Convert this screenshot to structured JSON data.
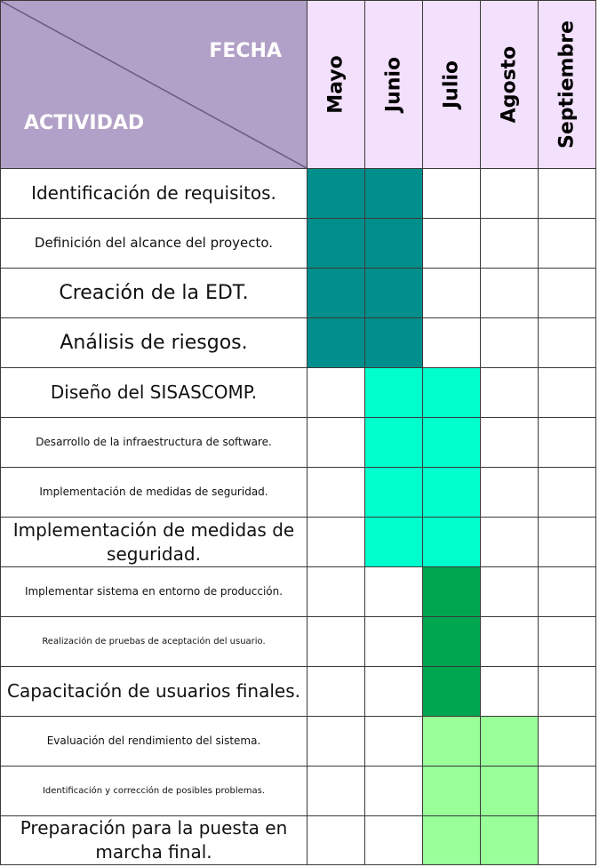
{
  "header": {
    "fecha_label": "FECHA",
    "actividad_label": "ACTIVIDAD",
    "months": [
      "Mayo",
      "Junio",
      "Julio",
      "Agosto",
      "Septiembre"
    ]
  },
  "colors": {
    "header_corner": "#b1a0c7",
    "header_month": "#f2e0fc",
    "phase_1": "#008f8c",
    "phase_2": "#00ffcc",
    "phase_3": "#00a650",
    "phase_4": "#99ff99"
  },
  "activities": [
    {
      "label": "Identificación de requisitos.",
      "months": [
        1,
        1,
        0,
        0,
        0
      ],
      "phase": 1
    },
    {
      "label": "Definición del alcance del proyecto.",
      "months": [
        1,
        1,
        0,
        0,
        0
      ],
      "phase": 1
    },
    {
      "label": "Creación de la EDT.",
      "months": [
        1,
        1,
        0,
        0,
        0
      ],
      "phase": 1
    },
    {
      "label": "Análisis de riesgos.",
      "months": [
        1,
        1,
        0,
        0,
        0
      ],
      "phase": 1
    },
    {
      "label": "Diseño del SISASCOMP.",
      "months": [
        0,
        1,
        1,
        0,
        0
      ],
      "phase": 2
    },
    {
      "label": "Desarrollo de la infraestructura de software.",
      "months": [
        0,
        1,
        1,
        0,
        0
      ],
      "phase": 2
    },
    {
      "label": "Implementación de medidas de seguridad.",
      "months": [
        0,
        1,
        1,
        0,
        0
      ],
      "phase": 2
    },
    {
      "label": "Implementación de medidas de seguridad.",
      "months": [
        0,
        1,
        1,
        0,
        0
      ],
      "phase": 2
    },
    {
      "label": "Implementar sistema en entorno de producción.",
      "months": [
        0,
        0,
        1,
        0,
        0
      ],
      "phase": 3
    },
    {
      "label": "Realización de pruebas de aceptación del usuario.",
      "months": [
        0,
        0,
        1,
        0,
        0
      ],
      "phase": 3
    },
    {
      "label": "Capacitación de usuarios finales.",
      "months": [
        0,
        0,
        1,
        0,
        0
      ],
      "phase": 3
    },
    {
      "label": "Evaluación del rendimiento del sistema.",
      "months": [
        0,
        0,
        1,
        1,
        0
      ],
      "phase": 4
    },
    {
      "label": "Identificación y corrección de posibles problemas.",
      "months": [
        0,
        0,
        1,
        1,
        0
      ],
      "phase": 4
    },
    {
      "label": "Preparación para la puesta en marcha final.",
      "months": [
        0,
        0,
        1,
        1,
        0
      ],
      "phase": 4
    }
  ]
}
